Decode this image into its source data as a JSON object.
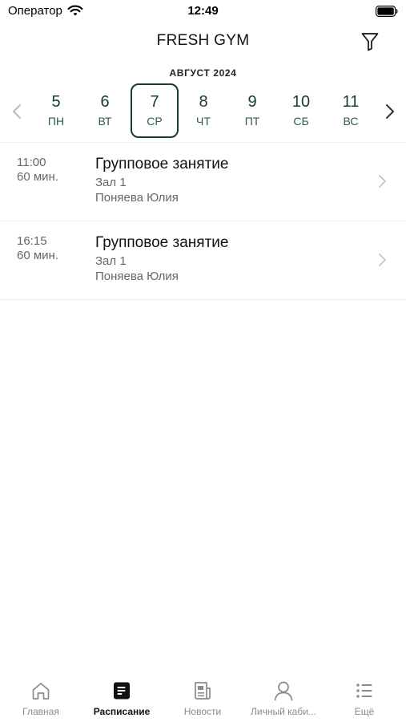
{
  "status_bar": {
    "carrier": "Оператор",
    "time": "12:49"
  },
  "header": {
    "title": "FRESH GYM",
    "filter_icon": "filter-icon"
  },
  "calendar": {
    "month": "АВГУСТ 2024",
    "selected_index": 2,
    "days": [
      {
        "num": "5",
        "weekday": "ПН"
      },
      {
        "num": "6",
        "weekday": "ВТ"
      },
      {
        "num": "7",
        "weekday": "СР"
      },
      {
        "num": "8",
        "weekday": "ЧТ"
      },
      {
        "num": "9",
        "weekday": "ПТ"
      },
      {
        "num": "10",
        "weekday": "СБ"
      },
      {
        "num": "11",
        "weekday": "ВС"
      }
    ]
  },
  "sessions": [
    {
      "time": "11:00",
      "duration": "60 мин.",
      "title": "Групповое занятие",
      "hall": "Зал 1",
      "trainer": "Поняева Юлия"
    },
    {
      "time": "16:15",
      "duration": "60 мин.",
      "title": "Групповое занятие",
      "hall": "Зал 1",
      "trainer": "Поняева Юлия"
    }
  ],
  "tab_bar": {
    "active": "schedule",
    "tabs": [
      {
        "id": "home",
        "label": "Главная",
        "icon": "home-icon"
      },
      {
        "id": "schedule",
        "label": "Расписание",
        "icon": "schedule-icon"
      },
      {
        "id": "news",
        "label": "Новости",
        "icon": "news-icon"
      },
      {
        "id": "account",
        "label": "Личный каби...",
        "icon": "person-icon"
      },
      {
        "id": "more",
        "label": "Ещё",
        "icon": "list-icon"
      }
    ]
  },
  "colors": {
    "accent": "#163b34",
    "muted_text": "#666666",
    "inactive_tab": "#8a8a8a"
  }
}
